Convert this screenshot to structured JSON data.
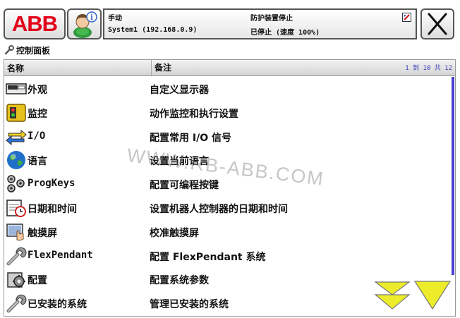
{
  "topbar": {
    "logo_text": "ABB",
    "status": {
      "mode": "手动",
      "system": "System1 (192.168.0.9)",
      "safety": "防护装置停止",
      "motion": "已停止 (速度 100%)"
    }
  },
  "breadcrumb": {
    "title": "控制面板"
  },
  "table": {
    "col_name": "名称",
    "col_note": "备注",
    "paging": "1 到 10 共 12",
    "rows": [
      {
        "name": "外观",
        "desc": "自定义显示器",
        "icon": "display-icon"
      },
      {
        "name": "监控",
        "desc": "动作监控和执行设置",
        "icon": "supervision-icon"
      },
      {
        "name": "I/O",
        "desc": "配置常用 I/O 信号",
        "icon": "io-arrows-icon"
      },
      {
        "name": "语言",
        "desc": "设置当前语言",
        "icon": "globe-icon"
      },
      {
        "name": "ProgKeys",
        "desc": "配置可编程按键",
        "icon": "progkeys-icon"
      },
      {
        "name": "日期和时间",
        "desc": "设置机器人控制器的日期和时间",
        "icon": "calendar-clock-icon"
      },
      {
        "name": "触摸屏",
        "desc": "校准触摸屏",
        "icon": "touchscreen-icon"
      },
      {
        "name": "FlexPendant",
        "desc": "配置 FlexPendant 系统",
        "icon": "wrench-icon"
      },
      {
        "name": "配置",
        "desc": "配置系统参数",
        "icon": "config-gear-icon"
      },
      {
        "name": "已安装的系统",
        "desc": "管理已安装的系统",
        "icon": "installed-system-icon"
      }
    ]
  },
  "scroll": {
    "visible_fraction": 0.83
  },
  "watermark": "WWW.RB-ABB.COM",
  "colors": {
    "abb_red": "#e2001a",
    "scroll_blue": "#4b3fd1",
    "nav_arrow_yellow": "#ecec2a"
  }
}
